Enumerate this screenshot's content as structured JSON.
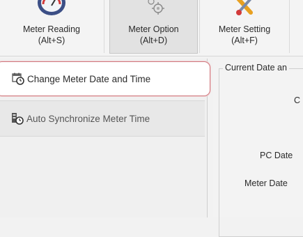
{
  "ribbon": {
    "buttons": [
      {
        "label_line1": "Meter Reading",
        "label_line2": "(Alt+S)",
        "icon": "meter-reading-icon",
        "active": false
      },
      {
        "label_line1": "Meter Option",
        "label_line2": "(Alt+D)",
        "icon": "gear-icon",
        "active": true
      },
      {
        "label_line1": "Meter Setting",
        "label_line2": "(Alt+F)",
        "icon": "tools-icon",
        "active": false
      }
    ]
  },
  "nav": {
    "items": [
      {
        "label": "Change Meter Date and Time",
        "icon": "calendar-clock-icon",
        "selected": true
      },
      {
        "label": "Auto Synchronize Meter Time",
        "icon": "sync-clock-icon",
        "selected": false
      }
    ]
  },
  "main": {
    "group_title": "Current Date an",
    "partial_label": "C",
    "pc_date_label": "PC Date",
    "meter_date_label": "Meter Date"
  },
  "colors": {
    "selection_border": "#d07a80",
    "ribbon_bg": "#f4f4f4"
  }
}
